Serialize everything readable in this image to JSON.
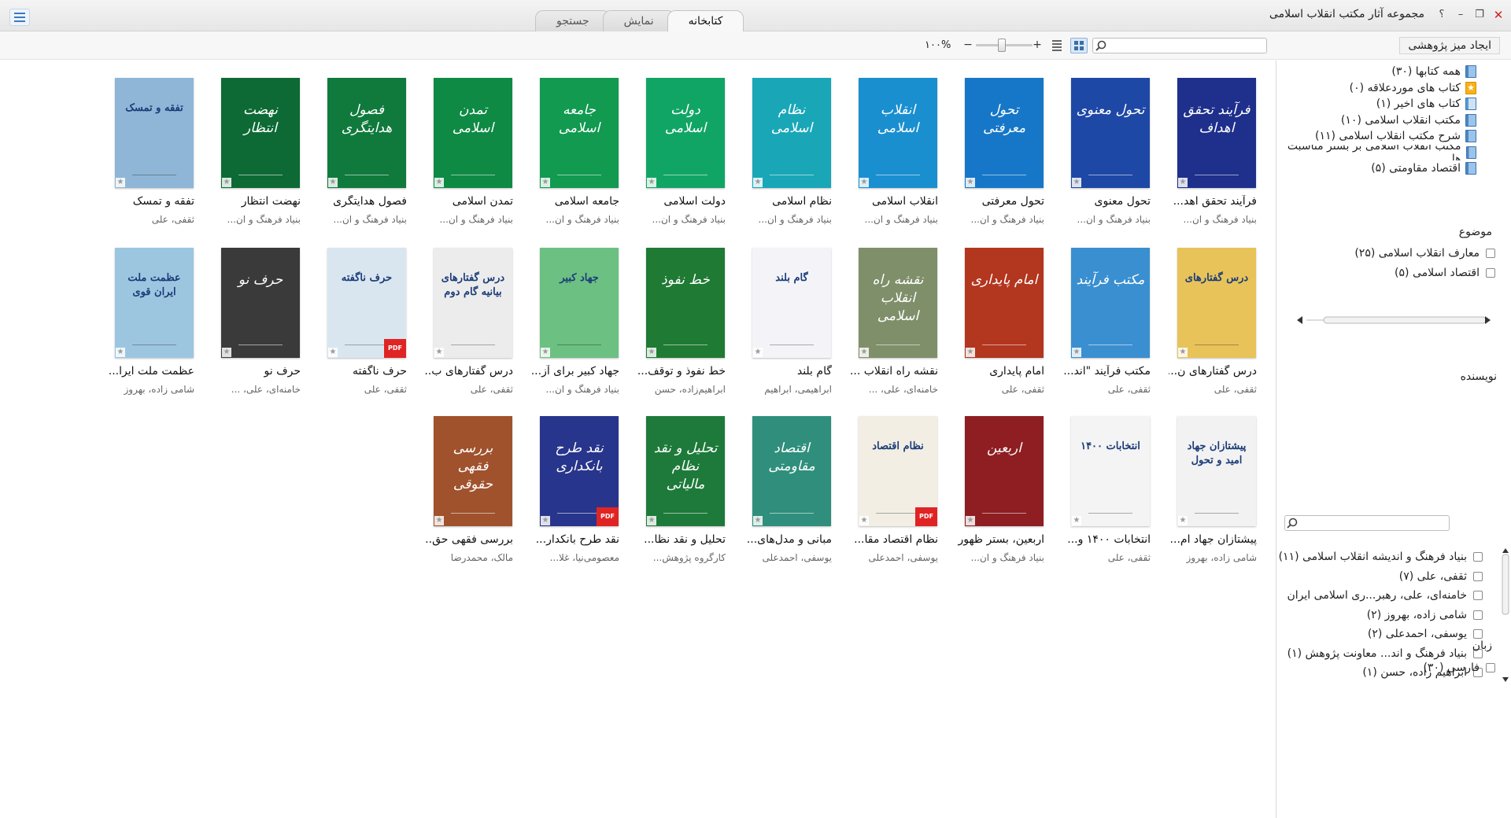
{
  "window": {
    "title": "مجموعه آثار مکتب انقلاب اسلامی",
    "controls": [
      "؟",
      "–",
      "❐",
      "✕"
    ]
  },
  "tabs": [
    "جستجو",
    "نمایش",
    "کتابخانه"
  ],
  "toolbar": {
    "research_desk": "ایجاد میز پژوهشی",
    "zoom": "۱۰۰%",
    "zoom_minus": "−",
    "zoom_plus": "+",
    "search_placeholder": ""
  },
  "books": [
    {
      "title": "فرآیند تحقق اهد...",
      "author": "بنیاد فرهنگ و ان...",
      "color": "#1f2f8c",
      "cover": "فرآیند تحقق اهداف",
      "pdf": false
    },
    {
      "title": "تحول معنوی",
      "author": "بنیاد فرهنگ و ان...",
      "color": "#1e48a6",
      "cover": "تحول معنوی",
      "pdf": false
    },
    {
      "title": "تحول معرفتی",
      "author": "بنیاد فرهنگ و ان...",
      "color": "#1677c8",
      "cover": "تحول معرفتی",
      "pdf": false
    },
    {
      "title": "انقلاب اسلامی",
      "author": "بنیاد فرهنگ و ان...",
      "color": "#1a8fd0",
      "cover": "انقلاب اسلامی",
      "pdf": false
    },
    {
      "title": "نظام اسلامی",
      "author": "بنیاد فرهنگ و ان...",
      "color": "#19a7b8",
      "cover": "نظام اسلامی",
      "pdf": false
    },
    {
      "title": "دولت اسلامی",
      "author": "بنیاد فرهنگ و ان...",
      "color": "#11a565",
      "cover": "دولت اسلامی",
      "pdf": false
    },
    {
      "title": "جامعه اسلامی",
      "author": "بنیاد فرهنگ و ان...",
      "color": "#119a50",
      "cover": "جامعه اسلامی",
      "pdf": false
    },
    {
      "title": "تمدن اسلامی",
      "author": "بنیاد فرهنگ و ان...",
      "color": "#0e8a44",
      "cover": "تمدن اسلامی",
      "pdf": false
    },
    {
      "title": "فصول هدایتگری",
      "author": "بنیاد فرهنگ و ان...",
      "color": "#0f7a3c",
      "cover": "فصول هدایتگری",
      "pdf": false
    },
    {
      "title": "نهضت انتظار",
      "author": "بنیاد فرهنگ و ان...",
      "color": "#0d6a35",
      "cover": "نهضت انتظار",
      "pdf": false
    },
    {
      "title": "تفقه و تمسک",
      "author": "ثقفی، علی",
      "color": "#8fb6d6",
      "cover": "تفقه و تمسک",
      "pdf": false
    },
    {
      "title": "درس گفتارهای ن...",
      "author": "ثقفی، علی",
      "color": "#e8c35a",
      "cover": "درس گفتارهای",
      "pdf": false
    },
    {
      "title": "مکتب فرآیند \"اند...",
      "author": "ثقفی، علی",
      "color": "#3a8fd0",
      "cover": "مکتب فرآیند",
      "pdf": false
    },
    {
      "title": "امام پایداری",
      "author": "ثقفی، علی",
      "color": "#b3361f",
      "cover": "امام پایداری",
      "pdf": false
    },
    {
      "title": "نقشه راه انقلاب ...",
      "author": "خامنه‌ای، علی، ...",
      "color": "#7f8f6a",
      "cover": "نقشه راه انقلاب اسلامی",
      "pdf": false
    },
    {
      "title": "گام بلند",
      "author": "ابراهیمی، ابراهیم",
      "color": "#f4f4f8",
      "cover": "گام بلند",
      "pdf": false
    },
    {
      "title": "خط نفوذ و توقف...",
      "author": "ابراهیم‌زاده، حسن",
      "color": "#1f7a34",
      "cover": "خط نفوذ",
      "pdf": false
    },
    {
      "title": "جهاد کبیر برای آز...",
      "author": "بنیاد فرهنگ و ان...",
      "color": "#6cc082",
      "cover": "جهاد کبیر",
      "pdf": false
    },
    {
      "title": "درس گفتارهای ب...",
      "author": "ثقفی، علی",
      "color": "#ececec",
      "cover": "درس گفتارهای بیانیه گام دوم",
      "pdf": false
    },
    {
      "title": "حرف ناگفته",
      "author": "ثقفی، علی",
      "color": "#d9e6f0",
      "cover": "حرف ناگفته",
      "pdf": true
    },
    {
      "title": "حرف نو",
      "author": "خامنه‌ای، علی، ...",
      "color": "#3a3a3a",
      "cover": "حرف نو",
      "pdf": false
    },
    {
      "title": "عظمت ملت ایرا...",
      "author": "شامی زاده، بهروز",
      "color": "#9cc6e0",
      "cover": "عظمت ملت ایران قوی",
      "pdf": false
    },
    {
      "title": "پیشتازان جهاد ام...",
      "author": "شامی زاده، بهروز",
      "color": "#f2f2f2",
      "cover": "پیشتازان جهاد امید و تحول",
      "pdf": false
    },
    {
      "title": "انتخابات ۱۴۰۰ و...",
      "author": "ثقفی، علی",
      "color": "#f4f4f4",
      "cover": "انتخابات ۱۴۰۰",
      "pdf": false
    },
    {
      "title": "اربعین، بستر ظهور",
      "author": "بنیاد فرهنگ و ان...",
      "color": "#8e1e22",
      "cover": "اربعین",
      "pdf": false
    },
    {
      "title": "نظام اقتصاد مقا...",
      "author": "یوسفی، احمدعلی",
      "color": "#f2eee4",
      "cover": "نظام اقتصاد",
      "pdf": true
    },
    {
      "title": "مبانی و مدل‌های...",
      "author": "یوسفی، احمدعلی",
      "color": "#2f8f7c",
      "cover": "اقتصاد مقاومتی",
      "pdf": false
    },
    {
      "title": "تحلیل و نقد نظا...",
      "author": "کارگروه پژوهش...",
      "color": "#1e7a3a",
      "cover": "تحلیل و نقد نظام مالیاتی",
      "pdf": false
    },
    {
      "title": "نقد طرح بانکدار...",
      "author": "معصومی‌نیا، غلا...",
      "color": "#28358c",
      "cover": "نقد طرح بانکداری",
      "pdf": true
    },
    {
      "title": "بررسی فقهی حق...",
      "author": "مالک، محمدرضا",
      "color": "#a0522d",
      "cover": "بررسی فقهی حقوقی",
      "pdf": false
    }
  ],
  "sidebar": {
    "categories": [
      {
        "label": "همه کتابها (۳۰)",
        "icon": "book-icon"
      },
      {
        "label": "کتاب های موردعلاقه (۰)",
        "icon": "star-icon"
      },
      {
        "label": "کتاب های اخیر (۱)",
        "icon": "book-icon"
      },
      {
        "label": "مکتب انقلاب اسلامی (۱۰)",
        "icon": "book-icon"
      },
      {
        "label": "شرح مکتب انقلاب اسلامی (۱۱)",
        "icon": "book-icon"
      },
      {
        "label": "مکتب انقلاب اسلامی بر بستر مناسبت ها",
        "icon": "book-icon"
      },
      {
        "label": "اقتصاد مقاومتی (۵)",
        "icon": "book-icon"
      }
    ],
    "subject_title": "موضوع",
    "subjects": [
      "معارف انقلاب اسلامی (۲۵)",
      "اقتصاد اسلامی (۵)"
    ],
    "author_title": "نویسنده",
    "authors": [
      "بنیاد فرهنگ و اندیشه انقلاب اسلامی (۱۱)",
      "ثقفی، علی (۷)",
      "خامنه‌ای، علی، رهبر...ری اسلامی ایران",
      "شامی زاده، بهروز (۲)",
      "یوسفی، احمدعلی (۲)",
      "بنیاد فرهنگ و اند... معاونت پژوهش (۱)",
      "ابراهیم زاده، حسن (۱)"
    ],
    "language_title": "زبان",
    "languages": [
      "فارسی (۳۰)"
    ]
  }
}
